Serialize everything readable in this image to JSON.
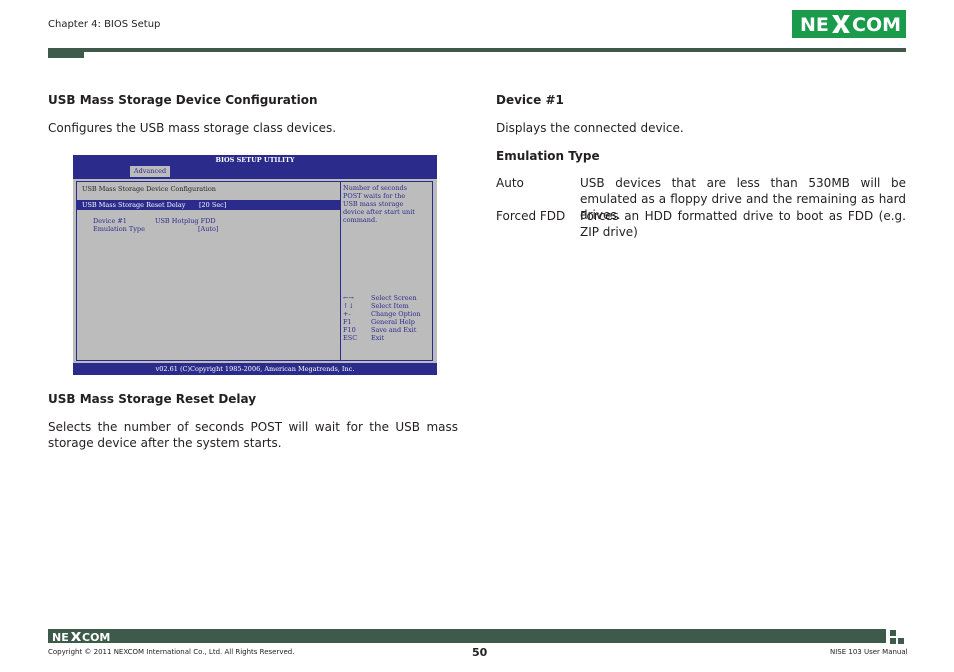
{
  "header": {
    "chapter": "Chapter 4: BIOS Setup",
    "logo_text": "NE COM"
  },
  "left": {
    "section1_heading": "USB Mass Storage Device Configuration",
    "section1_text": "Configures the USB mass storage class devices.",
    "section2_heading": "USB Mass Storage Reset Delay",
    "section2_text": "Selects the number of seconds POST will wait for the USB mass storage device after the system starts."
  },
  "bios": {
    "title": "BIOS SETUP UTILITY",
    "tab": "Advanced",
    "section_title": "USB Mass Storage Device Configuration",
    "reset_delay_label": "USB Mass Storage Reset Delay",
    "reset_delay_value": "[20 Sec]",
    "device_label": "Device #1",
    "device_value": "USB Hotplug FDD",
    "emulation_label": "Emulation Type",
    "emulation_value": "[Auto]",
    "help_lines": [
      "Number of seconds",
      "POST waits for the",
      "USB mass storage",
      "device after start unit",
      "command."
    ],
    "keys": [
      {
        "key": "←→",
        "desc": "Select Screen"
      },
      {
        "key": "↑↓",
        "desc": "Select Item"
      },
      {
        "key": "+-",
        "desc": "Change Option"
      },
      {
        "key": "F1",
        "desc": "General Help"
      },
      {
        "key": "F10",
        "desc": "Save and Exit"
      },
      {
        "key": "ESC",
        "desc": "Exit"
      }
    ],
    "footer": "v02.61 (C)Copyright 1985-2006, American Megatrends, Inc."
  },
  "right": {
    "device_heading": "Device #1",
    "device_text": "Displays the connected device.",
    "emulation_heading": "Emulation Type",
    "options": [
      {
        "term": "Auto",
        "desc": "USB devices that are less than 530MB will be emulated as a floppy drive and the remaining as hard drives."
      },
      {
        "term": "Forced FDD",
        "desc": "Forces an HDD formatted drive to boot as FDD (e.g. ZIP drive)"
      }
    ]
  },
  "footer": {
    "logo_text": "NE COM",
    "copyright": "Copyright © 2011 NEXCOM International Co., Ltd. All Rights Reserved.",
    "page": "50",
    "manual": "NISE 103 User Manual"
  },
  "colors": {
    "brand_green": "#1a9a4b",
    "bar_dark_green": "#3d5a4a",
    "bios_blue": "#2b2b8c",
    "bios_gray": "#bcbcbc"
  }
}
